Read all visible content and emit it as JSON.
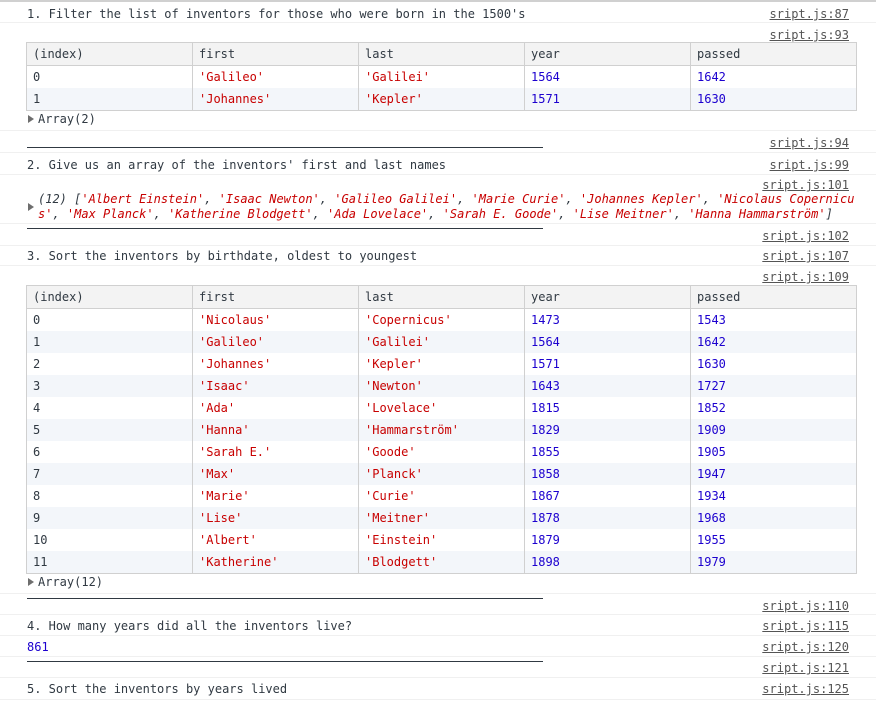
{
  "log": {
    "q1": "1. Filter the list of inventors for those who were born in the 1500's",
    "q2": "2. Give us an array of the inventors' first and last names",
    "q3": "3. Sort the inventors by birthdate, oldest to youngest",
    "q4": "4. How many years did all the inventors live?",
    "q5": "5. Sort the inventors by years lived",
    "separator": "____________________________________________________________________________",
    "q4_answer": "861"
  },
  "sources": {
    "s87": "sript.js:87",
    "s93": "sript.js:93",
    "s94": "sript.js:94",
    "s99": "sript.js:99",
    "s101": "sript.js:101",
    "s102": "sript.js:102",
    "s107": "sript.js:107",
    "s109": "sript.js:109",
    "s110": "sript.js:110",
    "s115": "sript.js:115",
    "s120": "sript.js:120",
    "s121": "sript.js:121",
    "s125": "sript.js:125"
  },
  "table_headers": [
    "(index)",
    "first",
    "last",
    "year",
    "passed"
  ],
  "table1": {
    "rows": [
      [
        "0",
        "'Galileo'",
        "'Galilei'",
        "1564",
        "1642"
      ],
      [
        "1",
        "'Johannes'",
        "'Kepler'",
        "1571",
        "1630"
      ]
    ],
    "array_label": "Array(2)"
  },
  "names_array": {
    "prefix": "(12) [",
    "items": [
      "'Albert Einstein'",
      "'Isaac Newton'",
      "'Galileo Galilei'",
      "'Marie Curie'",
      "'Johannes Kepler'",
      "'Nicolaus Copernicus'",
      "'Max Planck'",
      "'Katherine Blodgett'",
      "'Ada Lovelace'",
      "'Sarah E. Goode'",
      "'Lise Meitner'",
      "'Hanna Hammarström'"
    ],
    "suffix": "]"
  },
  "table2": {
    "rows": [
      [
        "0",
        "'Nicolaus'",
        "'Copernicus'",
        "1473",
        "1543"
      ],
      [
        "1",
        "'Galileo'",
        "'Galilei'",
        "1564",
        "1642"
      ],
      [
        "2",
        "'Johannes'",
        "'Kepler'",
        "1571",
        "1630"
      ],
      [
        "3",
        "'Isaac'",
        "'Newton'",
        "1643",
        "1727"
      ],
      [
        "4",
        "'Ada'",
        "'Lovelace'",
        "1815",
        "1852"
      ],
      [
        "5",
        "'Hanna'",
        "'Hammarström'",
        "1829",
        "1909"
      ],
      [
        "6",
        "'Sarah E.'",
        "'Goode'",
        "1855",
        "1905"
      ],
      [
        "7",
        "'Max'",
        "'Planck'",
        "1858",
        "1947"
      ],
      [
        "8",
        "'Marie'",
        "'Curie'",
        "1867",
        "1934"
      ],
      [
        "9",
        "'Lise'",
        "'Meitner'",
        "1878",
        "1968"
      ],
      [
        "10",
        "'Albert'",
        "'Einstein'",
        "1879",
        "1955"
      ],
      [
        "11",
        "'Katherine'",
        "'Blodgett'",
        "1898",
        "1979"
      ]
    ],
    "array_label": "Array(12)"
  },
  "colors": {
    "string": "#c80000",
    "number": "#1c00cf",
    "text": "#303942",
    "link": "#545454"
  }
}
